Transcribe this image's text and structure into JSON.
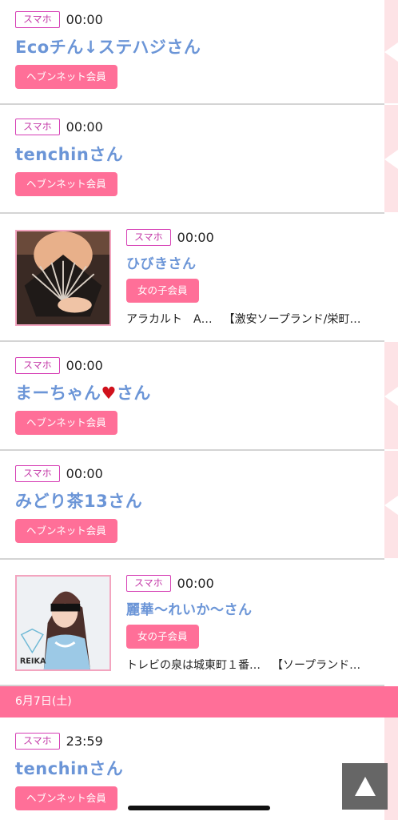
{
  "entries": [
    {
      "device": "スマホ",
      "time": "00:00",
      "name": "Ecoチん↓ステハジさん",
      "tag": "ヘブンネット会員"
    },
    {
      "device": "スマホ",
      "time": "00:00",
      "name": "tenchinさん",
      "tag": "ヘブンネット会員"
    },
    {
      "device": "スマホ",
      "time": "00:00",
      "name": "ひびきさん",
      "tag": "女の子会員",
      "shop_a": "アラカルト　A…",
      "shop_b": "【激安ソープランド/栄町…"
    },
    {
      "device": "スマホ",
      "time": "00:00",
      "name_pre": "まーちゃん",
      "heart": "♥",
      "name_post": "さん",
      "tag": "ヘブンネット会員"
    },
    {
      "device": "スマホ",
      "time": "00:00",
      "name": "みどり茶13さん",
      "tag": "ヘブンネット会員"
    },
    {
      "device": "スマホ",
      "time": "00:00",
      "name": "麗華〜れいか〜さん",
      "tag": "女の子会員",
      "shop_a": "トレビの泉は城東町１番…",
      "shop_b": "【ソープランド…"
    },
    {
      "device": "スマホ",
      "time": "23:59",
      "name": "tenchinさん",
      "tag": "ヘブンネット会員"
    }
  ],
  "date_header": "6月7日(土)",
  "photo_watermark": "REIKA",
  "colors": {
    "accent_pink": "#ff6f98",
    "name_blue": "#6b95d7",
    "badge_magenta": "#d63fb5",
    "side_strip": "#fde3e6"
  },
  "icons": {
    "scroll_top": "up-triangle-icon",
    "heart": "heart-icon"
  }
}
